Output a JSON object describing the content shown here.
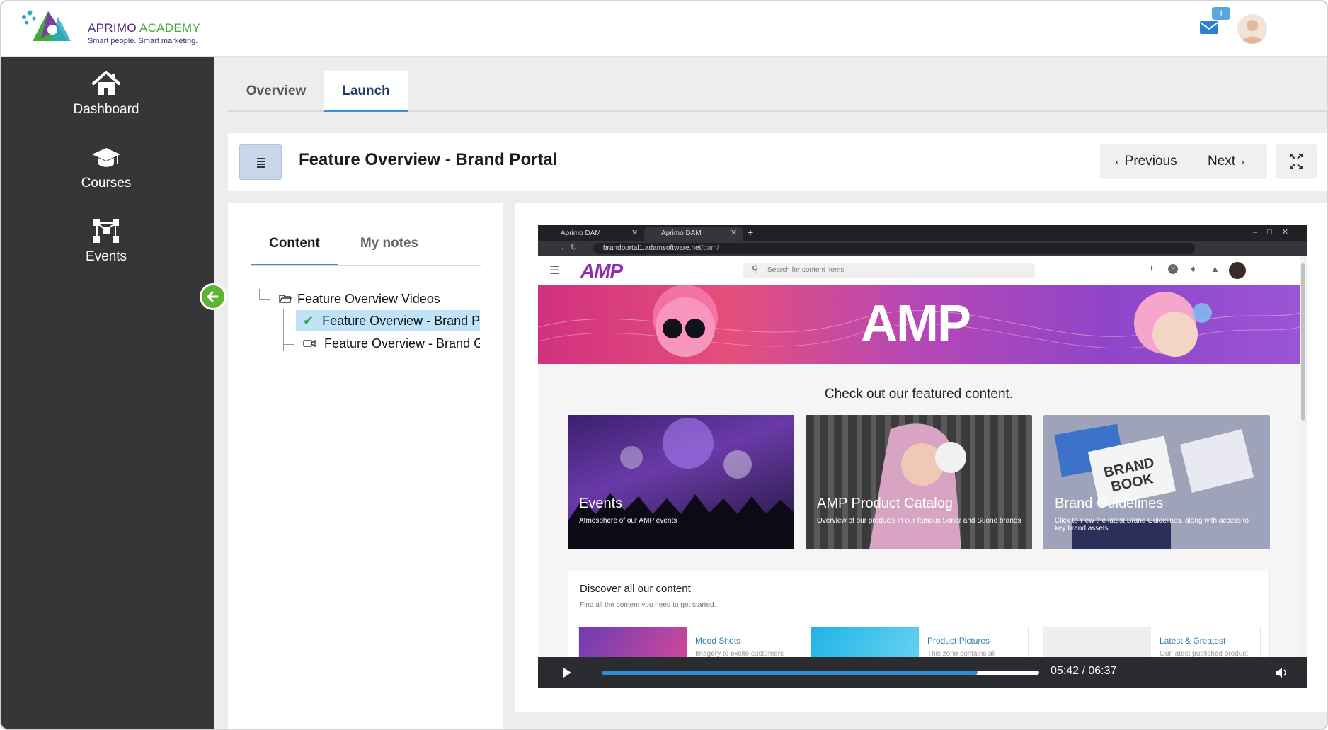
{
  "header": {
    "logo_brand": "APRIMO",
    "logo_name": "ACADEMY",
    "logo_tagline": "Smart people. Smart marketing.",
    "mail_icon": "envelope-icon",
    "mail_count": "1",
    "avatar_icon": "user-avatar"
  },
  "sidebar": {
    "items": [
      {
        "label": "Dashboard",
        "icon": "home-icon"
      },
      {
        "label": "Courses",
        "icon": "graduation-cap-icon"
      },
      {
        "label": "Events",
        "icon": "network-icon"
      }
    ],
    "collapse_icon": "arrow-left-icon"
  },
  "tabs": {
    "items": [
      {
        "label": "Overview",
        "active": false
      },
      {
        "label": "Launch",
        "active": true
      }
    ]
  },
  "lesson": {
    "title": "Feature Overview - Brand Portal",
    "prev_label": "Previous",
    "next_label": "Next",
    "menu_icon": "list-icon",
    "fullscreen_icon": "expand-icon"
  },
  "content_panel": {
    "tabs": [
      {
        "label": "Content",
        "active": true
      },
      {
        "label": "My notes",
        "active": false
      }
    ],
    "tree": {
      "folder": "Feature Overview Videos",
      "items": [
        {
          "label": "Feature Overview - Brand Portal",
          "status": "completed",
          "selected": true
        },
        {
          "label": "Feature Overview - Brand Guidelines",
          "status": "video",
          "selected": false
        }
      ]
    }
  },
  "video": {
    "browser": {
      "tabs": [
        "Aprimo DAM",
        "Aprimo DAM"
      ],
      "url_host": "brandportal1.adamsoftware.net",
      "url_path": "/dam/"
    },
    "app": {
      "logo": "AMP",
      "search_placeholder": "Search for content items",
      "banner_logo": "AMP",
      "featured_heading": "Check out our featured content.",
      "cards": [
        {
          "title": "Events",
          "desc": "Atmosphere of our AMP events"
        },
        {
          "title": "AMP Product Catalog",
          "desc": "Overview of our products in our famous Sonar and Suono brands"
        },
        {
          "title": "Brand Guidelines",
          "desc": "Click to view the latest Brand Guidelines, along with access to key brand assets"
        }
      ],
      "discover_title": "Discover all our content",
      "discover_sub": "Find all the content you need to get started.",
      "tiles": [
        {
          "title": "Mood Shots",
          "sub": "Imagery to excite customers"
        },
        {
          "title": "Product Pictures",
          "sub": "This zone contains all"
        },
        {
          "title": "Latest & Greatest",
          "sub": "Our latest published product"
        }
      ]
    },
    "player": {
      "time": "05:42 / 06:37",
      "progress": 0.86,
      "play_icon": "play-icon",
      "volume_icon": "volume-icon"
    }
  }
}
